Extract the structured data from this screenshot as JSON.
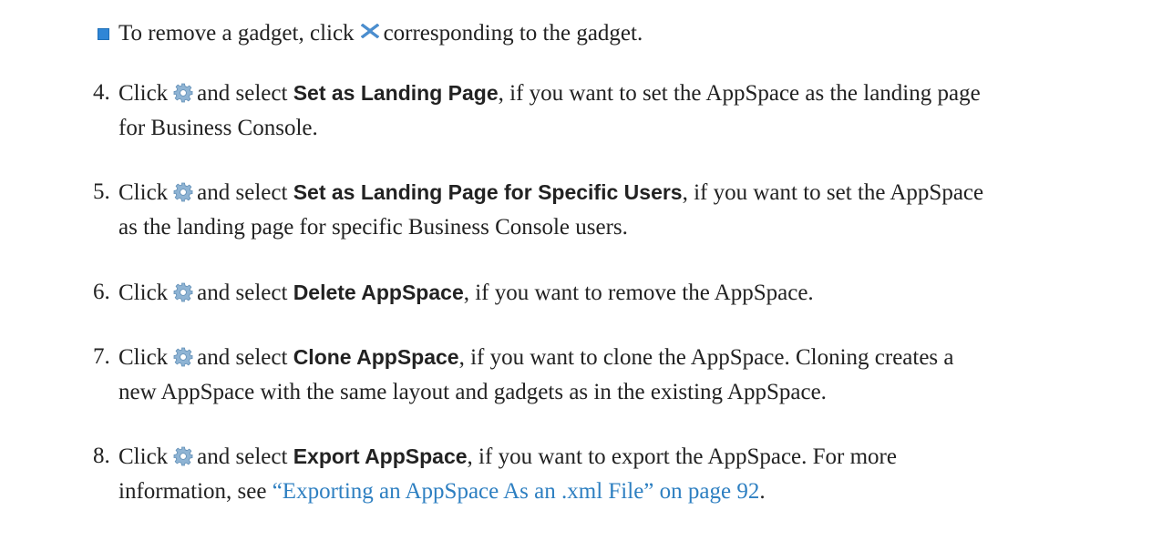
{
  "bullet": {
    "before_icon": "To remove a gadget, click",
    "icon": "close-icon",
    "after_icon": "corresponding to the gadget."
  },
  "steps": [
    {
      "number": "4.",
      "click": "Click",
      "icon": "gear-icon",
      "and_select": "and select",
      "bold": "Set as Landing Page",
      "rest": ", if you want to set the AppSpace as the landing page",
      "line2": "for Business Console."
    },
    {
      "number": "5.",
      "click": "Click",
      "icon": "gear-icon",
      "and_select": "and select",
      "bold": "Set as Landing Page for Specific Users",
      "rest": ", if you want to set the AppSpace",
      "line2": "as the landing page for specific Business Console users."
    },
    {
      "number": "6.",
      "click": "Click",
      "icon": "gear-icon",
      "and_select": "and select",
      "bold": "Delete AppSpace",
      "rest": ", if you want to remove the AppSpace."
    },
    {
      "number": "7.",
      "click": "Click",
      "icon": "gear-icon",
      "and_select": "and select",
      "bold": "Clone AppSpace",
      "rest": ", if you want to clone the AppSpace. Cloning creates a",
      "line2": "new AppSpace with the same layout and gadgets as in the existing AppSpace."
    },
    {
      "number": "8.",
      "click": "Click",
      "icon": "gear-icon",
      "and_select": "and select",
      "bold": "Export AppSpace",
      "rest": ", if you want to export the AppSpace. For more",
      "line2_before_link": "information, see ",
      "link_text": "“Exporting an AppSpace As an .xml File” on page 92",
      "line2_after_link": "."
    }
  ],
  "colors": {
    "text": "#222222",
    "link": "#2d7fc1",
    "bullet": "#2f86d6",
    "gear": "#7fa7c9",
    "close": "#4a8fd1"
  }
}
